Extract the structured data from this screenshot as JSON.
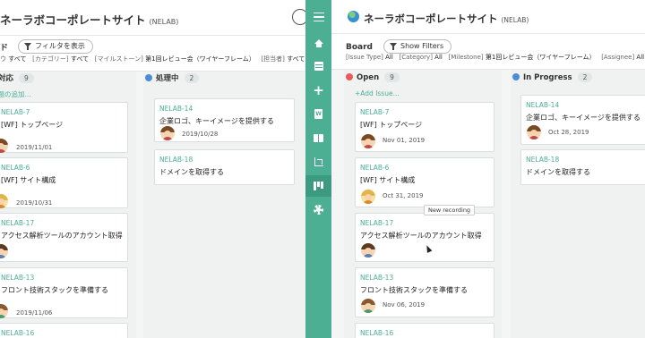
{
  "left": {
    "project_title": "ネーラボコーポレートサイト",
    "project_key": "(NELAB)",
    "board_title": "ド",
    "filter_button": "フィルタを表示",
    "filters": [
      {
        "label": "ウ",
        "value": "すべて"
      },
      {
        "label": "[カテゴリー]",
        "value": "すべて"
      },
      {
        "label": "[マイルストーン]",
        "value": "第1回レビュー会（ワイヤーフレーム）"
      },
      {
        "label": "[担当者]",
        "value": "すべて"
      }
    ],
    "columns": [
      {
        "name": "未対応",
        "display": "対応",
        "count": "9",
        "color": "#e85b5b",
        "add_label": "課題の追加..."
      },
      {
        "name": "処理中",
        "count": "2",
        "color": "#4c8bd8"
      }
    ],
    "open_cards": [
      {
        "key": "NELAB-7",
        "title": "[WF] トップページ",
        "date": "2019/11/01"
      },
      {
        "key": "NELAB-6",
        "title": "[WF] サイト構成",
        "date": "2019/10/31"
      },
      {
        "key": "NELAB-17",
        "title": "アクセス解析ツールのアカウント取得",
        "date": ""
      },
      {
        "key": "NELAB-13",
        "title": "フロント技術スタックを準備する",
        "date": "2019/11/06"
      },
      {
        "key": "NELAB-16",
        "title": "",
        "date": ""
      }
    ],
    "progress_cards": [
      {
        "key": "NELAB-14",
        "title": "企業ロゴ、キーイメージを提供する",
        "date": "2019/10/28"
      },
      {
        "key": "NELAB-18",
        "title": "ドメインを取得する",
        "date": ""
      }
    ]
  },
  "sidebar": {
    "items": [
      "menu-icon",
      "home-icon",
      "issues-icon",
      "add-icon",
      "wiki-icon",
      "files-icon",
      "git-icon",
      "board-icon",
      "settings-icon"
    ],
    "active": "board-icon",
    "color": "#4caf93"
  },
  "right": {
    "project_title": "ネーラボコーポレートサイト",
    "project_key": "(NELAB)",
    "board_title": "Board",
    "filter_button": "Show Filters",
    "filters": [
      {
        "label": "[Issue Type]",
        "value": "All"
      },
      {
        "label": "[Category]",
        "value": "All"
      },
      {
        "label": "[Milestone]",
        "value": "第1回レビュー会（ワイヤーフレーム）"
      },
      {
        "label": "[Assignee]",
        "value": "All"
      }
    ],
    "columns": [
      {
        "name": "Open",
        "count": "9",
        "color": "#e85b5b",
        "add_label": "+Add Issue..."
      },
      {
        "name": "In Progress",
        "count": "2",
        "color": "#4c8bd8"
      }
    ],
    "open_cards": [
      {
        "key": "NELAB-7",
        "title": "[WF] トップページ",
        "date": "Nov 01, 2019"
      },
      {
        "key": "NELAB-6",
        "title": "[WF] サイト構成",
        "date": "Oct 31, 2019"
      },
      {
        "key": "NELAB-17",
        "title": "アクセス解析ツールのアカウント取得",
        "date": ""
      },
      {
        "key": "NELAB-13",
        "title": "フロント技術スタックを準備する",
        "date": "Nov 06, 2019"
      },
      {
        "key": "NELAB-16",
        "title": "",
        "date": ""
      }
    ],
    "progress_cards": [
      {
        "key": "NELAB-14",
        "title": "企業ロゴ、キーイメージを提供する",
        "date": "Oct 28, 2019"
      },
      {
        "key": "NELAB-18",
        "title": "ドメインを取得する",
        "date": ""
      }
    ],
    "tooltip": "New recording"
  }
}
